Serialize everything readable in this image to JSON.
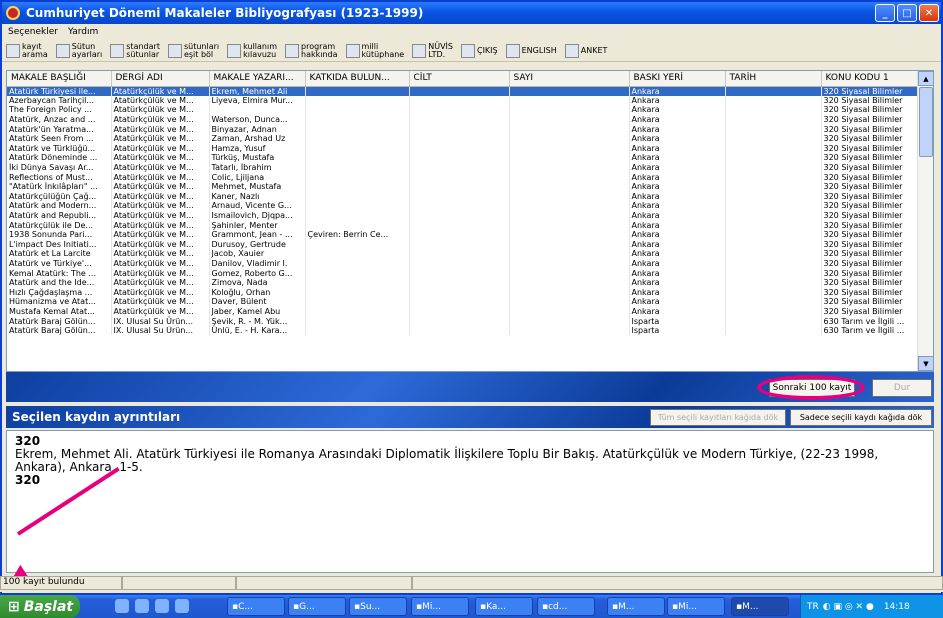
{
  "window": {
    "title": "Cumhuriyet Dönemi Makaleler Bibliyografyası (1923-1999)"
  },
  "menu": [
    "Seçenekler",
    "Yardım"
  ],
  "toolbar": [
    {
      "l1": "kayıt",
      "l2": "arama",
      "icon": "search-icon"
    },
    {
      "l1": "Sütun",
      "l2": "ayarları",
      "icon": "columns-icon"
    },
    {
      "l1": "standart",
      "l2": "sütunlar",
      "icon": "columns-icon"
    },
    {
      "l1": "sütunları",
      "l2": "eşit böl",
      "icon": "columns-icon"
    },
    {
      "l1": "kullanım",
      "l2": "kılavuzu",
      "icon": "book-icon"
    },
    {
      "l1": "program",
      "l2": "hakkında",
      "icon": "info-icon"
    },
    {
      "l1": "milli",
      "l2": "kütüphane",
      "icon": "library-icon"
    },
    {
      "l1": "NÜVİS",
      "l2": "LTD.",
      "icon": "logo-icon"
    },
    {
      "l1": "ÇIKIŞ",
      "l2": "",
      "icon": "exit-icon"
    },
    {
      "l1": "ENGLISH",
      "l2": "",
      "icon": "flag-icon"
    },
    {
      "l1": "ANKET",
      "l2": "",
      "icon": "help-icon"
    }
  ],
  "columns": [
    "MAKALE BAŞLIĞI",
    "DERGİ ADI",
    "MAKALE YAZARI...",
    "KATKIDA BULUN...",
    "CİLT",
    "SAYI",
    "BASKI YERİ",
    "TARİH",
    "KONU KODU 1"
  ],
  "rows": [
    [
      "Atatürk Türkiyesi ile...",
      "Atatürkçülük ve M...",
      "Ekrem, Mehmet Ali",
      "",
      "",
      "",
      "Ankara",
      "",
      "320 Siyasal Bilimler"
    ],
    [
      "Azerbaycan Tarihçil...",
      "Atatürkçülük ve M...",
      "Liyeva, Elmira Mur...",
      "",
      "",
      "",
      "Ankara",
      "",
      "320 Siyasal Bilimler"
    ],
    [
      "The Foreign Policy ...",
      "Atatürkçülük ve M...",
      "",
      "",
      "",
      "",
      "Ankara",
      "",
      "320 Siyasal Bilimler"
    ],
    [
      "Atatürk, Anzac and ...",
      "Atatürkçülük ve M...",
      "Waterson, Dunca...",
      "",
      "",
      "",
      "Ankara",
      "",
      "320 Siyasal Bilimler"
    ],
    [
      "Atatürk'ün Yaratma...",
      "Atatürkçülük ve M...",
      "Binyazar, Adnan",
      "",
      "",
      "",
      "Ankara",
      "",
      "320 Siyasal Bilimler"
    ],
    [
      "Atatürk Seen From ...",
      "Atatürkçülük ve M...",
      "Zaman, Arshad Uz",
      "",
      "",
      "",
      "Ankara",
      "",
      "320 Siyasal Bilimler"
    ],
    [
      "Atatürk ve Türklüğü...",
      "Atatürkçülük ve M...",
      "Hamza, Yusuf",
      "",
      "",
      "",
      "Ankara",
      "",
      "320 Siyasal Bilimler"
    ],
    [
      "Atatürk Döneminde ...",
      "Atatürkçülük ve M...",
      "Türküş, Mustafa",
      "",
      "",
      "",
      "Ankara",
      "",
      "320 Siyasal Bilimler"
    ],
    [
      "İki Dünya Savaşı Ar...",
      "Atatürkçülük ve M...",
      "Tatarlı, İbrahim",
      "",
      "",
      "",
      "Ankara",
      "",
      "320 Siyasal Bilimler"
    ],
    [
      "Reflections of Must...",
      "Atatürkçülük ve M...",
      "Colic, Ljiljana",
      "",
      "",
      "",
      "Ankara",
      "",
      "320 Siyasal Bilimler"
    ],
    [
      "\"Atatürk İnkılâpları\" ...",
      "Atatürkçülük ve M...",
      "Mehmet, Mustafa",
      "",
      "",
      "",
      "Ankara",
      "",
      "320 Siyasal Bilimler"
    ],
    [
      "Atatürkçülüğün Çağ...",
      "Atatürkçülük ve M...",
      "Kaner, Nazlı",
      "",
      "",
      "",
      "Ankara",
      "",
      "320 Siyasal Bilimler"
    ],
    [
      "Atatürk and Modern...",
      "Atatürkçülük ve M...",
      "Arnaud, Vicente G...",
      "",
      "",
      "",
      "Ankara",
      "",
      "320 Siyasal Bilimler"
    ],
    [
      "Atatürk and Republi...",
      "Atatürkçülük ve M...",
      "Ismailovich, Djqpa...",
      "",
      "",
      "",
      "Ankara",
      "",
      "320 Siyasal Bilimler"
    ],
    [
      "Atatürkçülük ile De...",
      "Atatürkçülük ve M...",
      "Şahinler, Menter",
      "",
      "",
      "",
      "Ankara",
      "",
      "320 Siyasal Bilimler"
    ],
    [
      "1938 Sonunda Pari...",
      "Atatürkçülük ve M...",
      "Grammont, Jean - ...",
      "Çeviren: Berrin Ce...",
      "",
      "",
      "Ankara",
      "",
      "320 Siyasal Bilimler"
    ],
    [
      "L'impact Des Initiati...",
      "Atatürkçülük ve M...",
      "Durusoy, Gertrude",
      "",
      "",
      "",
      "Ankara",
      "",
      "320 Siyasal Bilimler"
    ],
    [
      "Atatürk et La Larcite",
      "Atatürkçülük ve M...",
      "Jacob, Xauier",
      "",
      "",
      "",
      "Ankara",
      "",
      "320 Siyasal Bilimler"
    ],
    [
      "Atatürk ve Türkiye'...",
      "Atatürkçülük ve M...",
      "Danilov, Vladimir I.",
      "",
      "",
      "",
      "Ankara",
      "",
      "320 Siyasal Bilimler"
    ],
    [
      "Kemal Atatürk: The ...",
      "Atatürkçülük ve M...",
      "Gomez, Roberto G...",
      "",
      "",
      "",
      "Ankara",
      "",
      "320 Siyasal Bilimler"
    ],
    [
      "Atatürk and the Ide...",
      "Atatürkçülük ve M...",
      "Zimova, Nada",
      "",
      "",
      "",
      "Ankara",
      "",
      "320 Siyasal Bilimler"
    ],
    [
      "Hızlı Çağdaşlaşma ...",
      "Atatürkçülük ve M...",
      "Koloğlu, Orhan",
      "",
      "",
      "",
      "Ankara",
      "",
      "320 Siyasal Bilimler"
    ],
    [
      "Hümanizma ve Atat...",
      "Atatürkçülük ve M...",
      "Daver, Bülent",
      "",
      "",
      "",
      "Ankara",
      "",
      "320 Siyasal Bilimler"
    ],
    [
      "Mustafa Kemal Atat...",
      "Atatürkçülük ve M...",
      "Jaber, Kamel Abu",
      "",
      "",
      "",
      "Ankara",
      "",
      "320 Siyasal Bilimler"
    ],
    [
      "Atatürk Baraj Gölün...",
      "IX. Ulusal Su Ürün...",
      "Şevik, R. - M. Yük...",
      "",
      "",
      "",
      "Isparta",
      "",
      "630 Tarım ve İlgili ..."
    ],
    [
      "Atatürk Baraj Gölün...",
      "IX. Ulusal Su Ürün...",
      "Ünlü, E. - H. Kara...",
      "",
      "",
      "",
      "Isparta",
      "",
      "630 Tarım ve İlgili ..."
    ]
  ],
  "buttons": {
    "next": "Sonraki 100 kayıt",
    "stop": "Dur",
    "print_all": "Tüm seçili kayıtları kağıda dök",
    "print_sel": "Sadece seçili kaydı kağıda dök"
  },
  "detail": {
    "heading": "Seçilen kaydın ayrıntıları",
    "code1": "320",
    "text": "Ekrem, Mehmet Ali. Atatürk Türkiyesi ile Romanya Arasındaki Diplomatik İlişkilere Toplu Bir Bakış. Atatürkçülük ve Modern Türkiye, (22-23 1998, Ankara), Ankara, 1-5.",
    "code2": "320"
  },
  "status": {
    "count": "100 kayıt bulundu"
  },
  "taskbar": {
    "start": "Başlat",
    "tasks": [
      "C...",
      "G...",
      "Su...",
      "Mi...",
      "Ka...",
      "cd...",
      "M...",
      "Mi...",
      "M..."
    ],
    "lang": "TR",
    "time": "14:18"
  },
  "colors": {
    "selection": "#316ac5",
    "annotation": "#e6007e"
  }
}
